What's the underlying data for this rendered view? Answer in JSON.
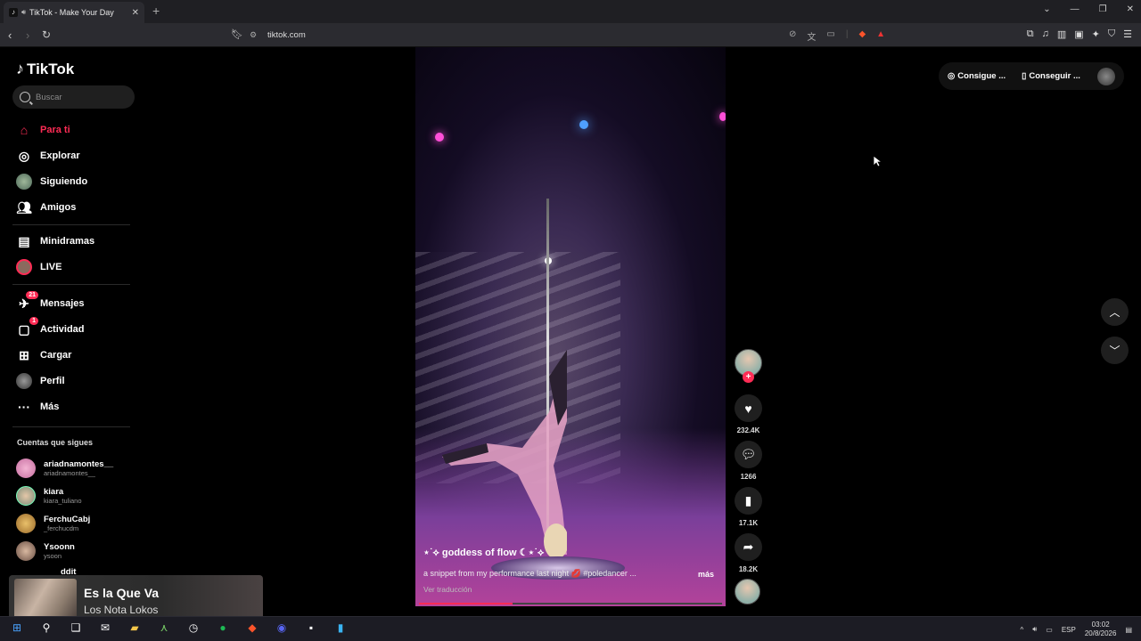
{
  "browser": {
    "tab_title": "TikTok - Make Your Day",
    "url": "tiktok.com"
  },
  "sidebar": {
    "logo": "TikTok",
    "search_placeholder": "Buscar",
    "nav": [
      {
        "label": "Para ti",
        "icon": "home-icon",
        "active": true
      },
      {
        "label": "Explorar",
        "icon": "compass-icon"
      },
      {
        "label": "Siguiendo",
        "icon": "following-avatar-icon"
      },
      {
        "label": "Amigos",
        "icon": "friends-icon"
      },
      {
        "label": "Minidramas",
        "icon": "minidrama-icon"
      },
      {
        "label": "LIVE",
        "icon": "live-icon"
      },
      {
        "label": "Mensajes",
        "icon": "messages-icon",
        "badge": "21"
      },
      {
        "label": "Actividad",
        "icon": "activity-icon",
        "badge": "1"
      },
      {
        "label": "Cargar",
        "icon": "upload-icon"
      },
      {
        "label": "Perfil",
        "icon": "profile-icon"
      },
      {
        "label": "Más",
        "icon": "more-icon"
      }
    ],
    "following_title": "Cuentas que sigues",
    "following": [
      {
        "name": "ariadnamontes__",
        "handle": "ariadnamontes__"
      },
      {
        "name": "kiara",
        "handle": "kiara_tuliano"
      },
      {
        "name": "FerchuCabj",
        "handle": "_ferchucdm"
      },
      {
        "name": "Ysoonn",
        "handle": "ysoon"
      },
      {
        "name": "ddit",
        "handle": ""
      }
    ]
  },
  "media_popup": {
    "song": "Es la Que Va",
    "artist": "Los Nota Lokos"
  },
  "video": {
    "caption": "⋆˙⟡ goddess of flow ☾⋆˙⟡",
    "description": "a snippet from my performance last night 💋 #poledancer ...",
    "more": "más",
    "translate": "Ver traducción",
    "progress": 0.31
  },
  "actions": {
    "likes": "232.4K",
    "comments": "1266",
    "saves": "17.1K",
    "shares": "18.2K"
  },
  "topright": {
    "get_coins": "Consigue ...",
    "get_app": "Conseguir ..."
  },
  "taskbar": {
    "lang": "ESP",
    "time": "03:02",
    "date": "20/8/2026"
  },
  "colors": {
    "accent": "#fe2c55",
    "background": "#000000"
  }
}
